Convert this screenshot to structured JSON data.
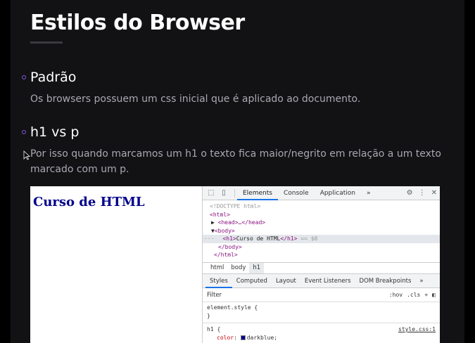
{
  "slide": {
    "title": "Estilos do Browser",
    "items": [
      {
        "heading": "Padrão",
        "text": "Os browsers possuem um css inicial que é aplicado ao documento."
      },
      {
        "heading": "h1 vs p",
        "text_line1": "Por isso quando marcamos um h1 o texto fica maior/negrito em relação a um texto",
        "text_line2": "marcado com um p."
      }
    ]
  },
  "colors": {
    "accent": "#8257e5",
    "slide_bg": "#121214",
    "h1_color": "#00008b"
  },
  "browser": {
    "page_heading": "Curso de HTML",
    "devtools": {
      "tabs": [
        "Elements",
        "Console",
        "Application",
        "»"
      ],
      "active_tab": "Elements",
      "dom": {
        "doctype": "<!DOCTYPE html>",
        "html_open": "<html>",
        "head": "<head>…</head>",
        "body_open": "<body>",
        "h1_open": "<h1>",
        "h1_text": "Curso de HTML",
        "h1_close": "</h1>",
        "selected_suffix": " == $0",
        "body_close": "</body>",
        "html_close": "</html>",
        "ellipsis": "···"
      },
      "breadcrumbs": [
        "html",
        "body",
        "h1"
      ],
      "sub_tabs": [
        "Styles",
        "Computed",
        "Layout",
        "Event Listeners",
        "DOM Breakpoints",
        "»"
      ],
      "filter_placeholder": "Filter",
      "filter_tools": [
        ":hov",
        ".cls",
        "+"
      ],
      "styles": {
        "element_style_open": "element.style {",
        "close_brace": "}",
        "rule_selector": "h1 {",
        "rule_source": "style.css:1",
        "rule_prop": "color",
        "rule_value": "darkblue;"
      }
    }
  }
}
